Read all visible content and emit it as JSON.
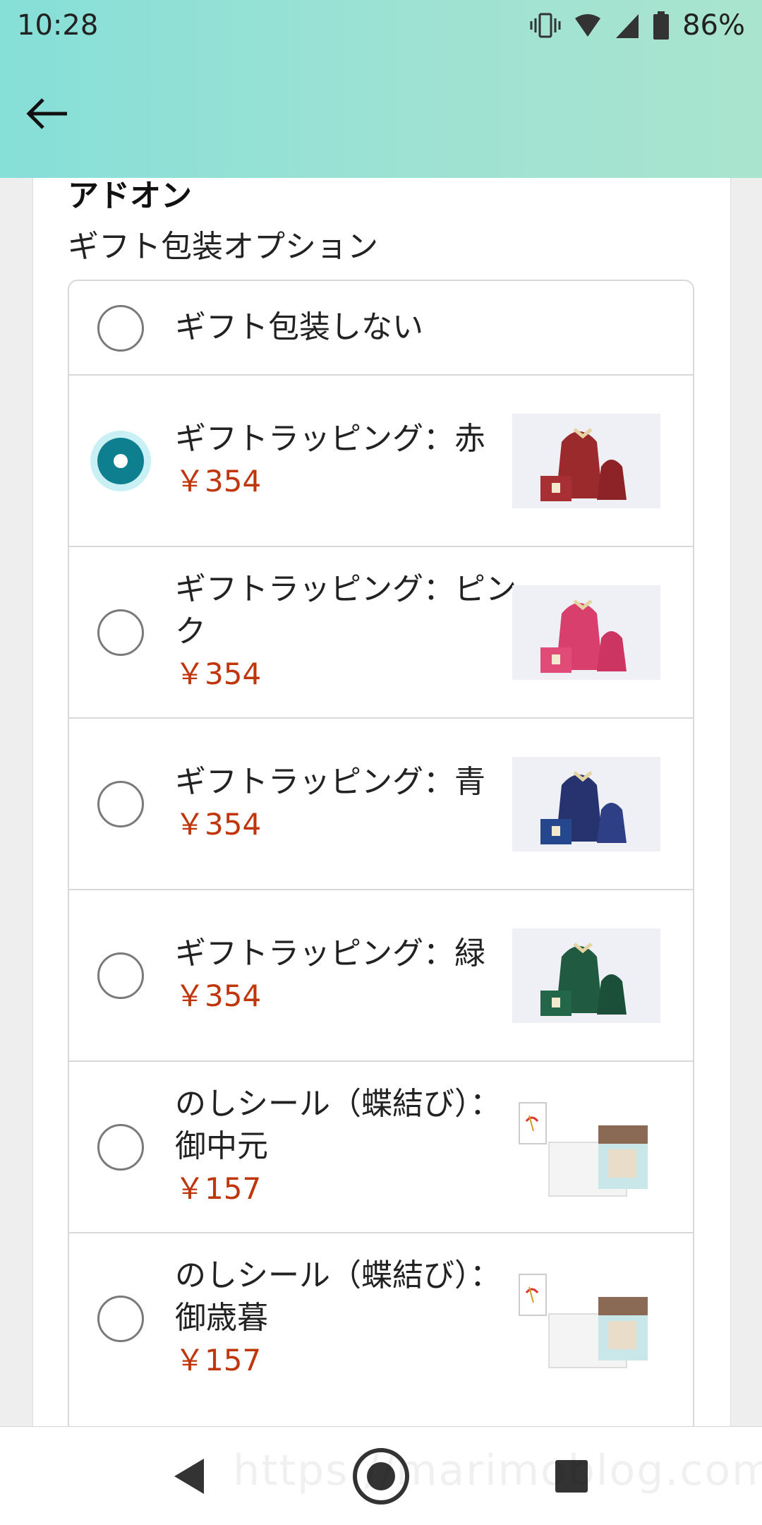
{
  "status_bar": {
    "time": "10:28",
    "battery": "86%"
  },
  "section": {
    "title": "アドオン",
    "subtitle": "ギフト包装オプション"
  },
  "options": [
    {
      "label": "ギフト包装しない",
      "price": "",
      "selected": false
    },
    {
      "label": "ギフトラッピング：赤",
      "price": "￥354",
      "selected": true,
      "color": "#9b2a2d",
      "icon": "gift-bag-red"
    },
    {
      "label": "ギフトラッピング：ピンク",
      "price": "￥354",
      "selected": false,
      "color": "#d83f6d",
      "icon": "gift-bag-pink"
    },
    {
      "label": "ギフトラッピング：青",
      "price": "￥354",
      "selected": false,
      "color": "#26336f",
      "icon": "gift-bag-blue"
    },
    {
      "label": "ギフトラッピング：緑",
      "price": "￥354",
      "selected": false,
      "color": "#1f5a41",
      "icon": "gift-bag-green"
    },
    {
      "label": "のしシール（蝶結び）：御中元",
      "price": "￥157",
      "selected": false,
      "icon": "noshi-seal"
    },
    {
      "label": "のしシール（蝶結び）：御歳暮",
      "price": "￥157",
      "selected": false,
      "icon": "noshi-seal"
    }
  ],
  "watermark": "https://marimoblog.com",
  "colors": {
    "accent": "#0e7f8f",
    "price": "#c0360c"
  }
}
